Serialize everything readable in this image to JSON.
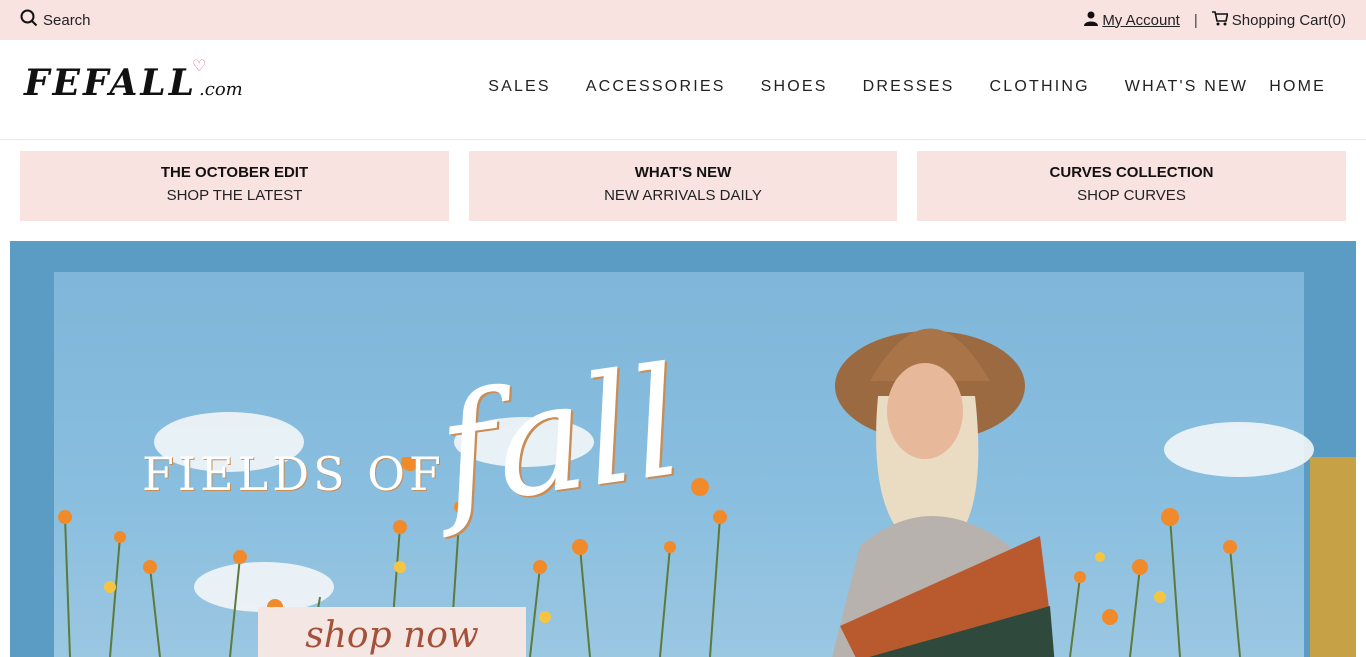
{
  "topbar": {
    "search_label": "Search",
    "account_label": "My Account",
    "separator": "|",
    "cart_label": "Shopping Cart(0)",
    "icons": [
      "search-icon",
      "user-icon",
      "cart-icon"
    ]
  },
  "logo": {
    "main": "FEFALL",
    "suffix": ".com",
    "heart": "♡"
  },
  "nav": [
    "SALES",
    "ACCESSORIES",
    "SHOES",
    "DRESSES",
    "CLOTHING",
    "WHAT'S NEW",
    "HOME"
  ],
  "promos": [
    {
      "title": "THE OCTOBER EDIT",
      "subtitle": "SHOP THE LATEST"
    },
    {
      "title": "WHAT'S NEW",
      "subtitle": "NEW ARRIVALS DAILY"
    },
    {
      "title": "CURVES COLLECTION",
      "subtitle": "SHOP CURVES"
    }
  ],
  "hero": {
    "headline": "FIELDS OF",
    "script": "fall",
    "cta": "shop now"
  },
  "colors": {
    "topbar_bg": "#f8e3e1",
    "promo_bg": "#f8e3e1",
    "hero_sky": "#7fb6d9",
    "cta_text": "#a5513a"
  }
}
